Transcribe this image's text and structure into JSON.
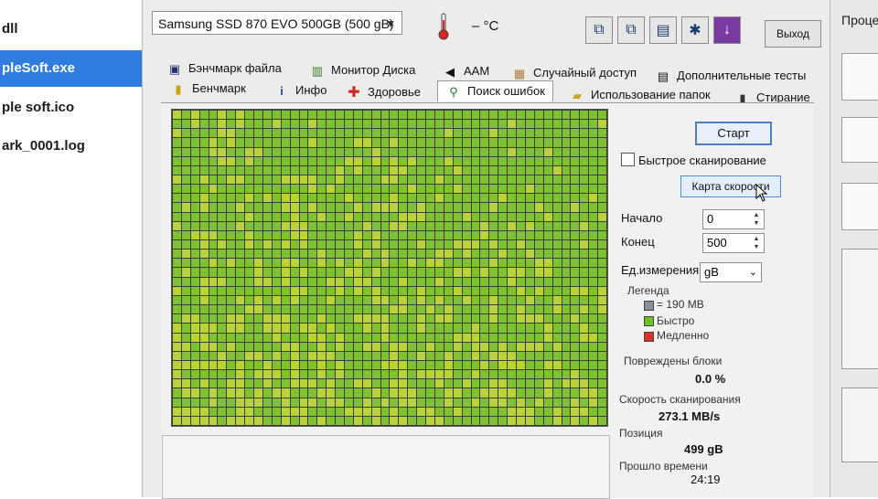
{
  "explorer": {
    "items": [
      {
        "name": "dll",
        "selected": false
      },
      {
        "name": "pleSoft.exe",
        "selected": true
      },
      {
        "name": "ple soft.ico",
        "selected": false
      },
      {
        "name": "ark_0001.log",
        "selected": false
      }
    ]
  },
  "toolbar": {
    "drive": "Samsung SSD 870 EVO 500GB (500 gB)",
    "temperature": "– °C",
    "exit_label": "Выход",
    "icons": [
      "copy-icon",
      "copy-text-icon",
      "save-icon",
      "options-icon",
      "download-icon"
    ]
  },
  "tabs_row1": [
    {
      "label": "Бэнчмарк файла",
      "icon": "file-benchmark-icon",
      "glyph": "▣"
    },
    {
      "label": "Монитор Диска",
      "icon": "disk-monitor-icon",
      "glyph": "▥"
    },
    {
      "label": "AAM",
      "icon": "speaker-icon",
      "glyph": "◀"
    },
    {
      "label": "Случайный доступ",
      "icon": "random-access-icon",
      "glyph": "▦"
    },
    {
      "label": "Дополнительные тесты",
      "icon": "extra-tests-icon",
      "glyph": "▤"
    }
  ],
  "tabs_row2": [
    {
      "label": "Бенчмарк",
      "icon": "benchmark-icon",
      "glyph": "▮"
    },
    {
      "label": "Инфо",
      "icon": "info-icon",
      "glyph": "i"
    },
    {
      "label": "Здоровье",
      "icon": "health-cross-icon",
      "glyph": "✚"
    },
    {
      "label": "Поиск ошибок",
      "icon": "magnifier-icon",
      "glyph": "⚲",
      "active": true
    },
    {
      "label": "Использование папок",
      "icon": "folder-icon",
      "glyph": "▰"
    },
    {
      "label": "Стирание",
      "icon": "trash-icon",
      "glyph": "▮"
    }
  ],
  "scan": {
    "start_label": "Старт",
    "quick_scan_label": "Быстрое сканирование",
    "quick_scan_checked": false,
    "speed_map_label": "Карта скорости",
    "start_field_label": "Начало",
    "start_value": "0",
    "end_field_label": "Конец",
    "end_value": "500",
    "unit_label": "Ед.измерения",
    "unit_value": "gB",
    "legend_title": "Легенда",
    "legend": [
      {
        "label": "= 190 MB",
        "color": "#8a8f99"
      },
      {
        "label": "Быстро",
        "color": "#6fbf2a"
      },
      {
        "label": "Медленно",
        "color": "#d8322a"
      }
    ],
    "damaged_label": "Повреждены блоки",
    "damaged_value": "0.0 %",
    "scan_speed_label": "Скорость сканирования",
    "scan_speed_value": "273.1 MB/s",
    "position_label": "Позиция",
    "position_value": "499 gB",
    "elapsed_label": "Прошло времени",
    "elapsed_value": "24:19"
  },
  "grid": {
    "columns": 48,
    "rows": 34,
    "fast_color": "#7fc232",
    "yellow_color": "#b9d43a"
  },
  "side_panel": {
    "title": "Проце"
  }
}
